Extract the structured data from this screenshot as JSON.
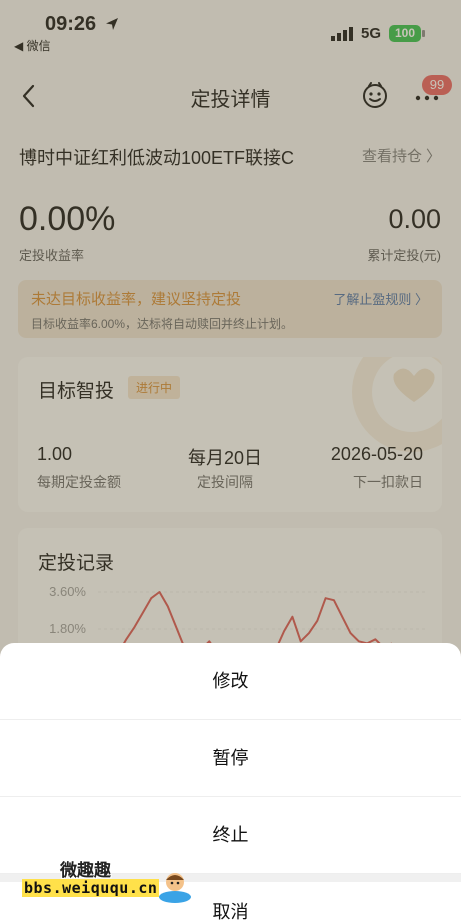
{
  "status_bar": {
    "time": "09:26",
    "back_app": "◀ 微信",
    "network": "5G",
    "battery": "100"
  },
  "nav": {
    "title": "定投详情",
    "badge": "99"
  },
  "fund": {
    "name": "博时中证红利低波动100ETF联接C",
    "holding_link": "查看持仓"
  },
  "summary": {
    "rate_value": "0.00%",
    "rate_label": "定投收益率",
    "total_value": "0.00",
    "total_label": "累计定投(元)"
  },
  "notice": {
    "warning": "未达目标收益率，建议坚持定投",
    "link": "了解止盈规则 〉",
    "detail": "目标收益率6.00%，达标将自动赎回并终止计划。"
  },
  "plan": {
    "title": "目标智投",
    "status": "进行中",
    "amount_value": "1.00",
    "amount_label": "每期定投金额",
    "interval_value": "每月20日",
    "interval_label": "定投间隔",
    "next_value": "2026-05-20",
    "next_label": "下一扣款日"
  },
  "record": {
    "title": "定投记录"
  },
  "chart_data": {
    "type": "line",
    "yticks": [
      "3.60%",
      "1.80%"
    ],
    "ylim": [
      0,
      3.6
    ],
    "series": [
      {
        "color": "#d9534f",
        "values": [
          0.6,
          1.3,
          1.9,
          2.6,
          3.3,
          3.6,
          2.9,
          1.9,
          0.9,
          0.5,
          0.8,
          1.2,
          0.6,
          0.4,
          0.7,
          0.5,
          0.6,
          0.4,
          0.5,
          0.8,
          1.7,
          2.4,
          1.2,
          1.6,
          2.2,
          3.3,
          3.2,
          2.4,
          1.6,
          1.2,
          1.1,
          1.3,
          0.9,
          1.1
        ]
      }
    ]
  },
  "sheet": {
    "modify": "修改",
    "pause": "暂停",
    "terminate": "终止",
    "cancel": "取消"
  },
  "watermark": {
    "title": "微趣趣",
    "site": "bbs.weiququ.cn"
  }
}
